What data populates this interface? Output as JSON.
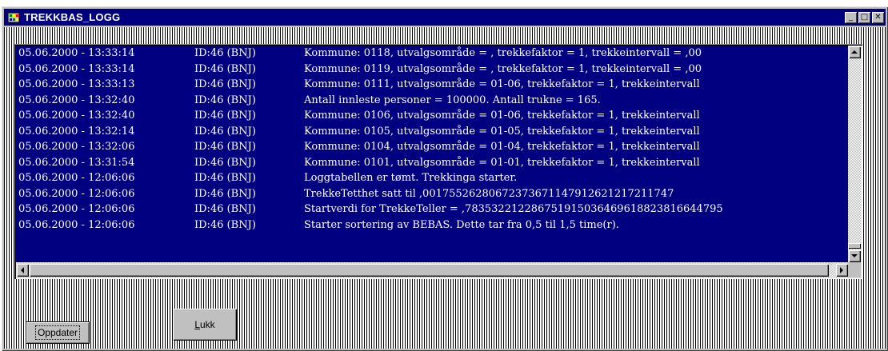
{
  "window": {
    "title": "TREKKBAS_LOGG",
    "controls": {
      "minimize": "_",
      "maximize": "□",
      "close": "✕"
    },
    "app_icon": "app-grid-icon",
    "colors": {
      "titlebar": "#000080",
      "face": "#c0c0c0",
      "selection": "#000080"
    }
  },
  "log": {
    "rows": [
      {
        "timestamp": "05.06.2000 - 13:33:14",
        "id": "ID:46 (BNJ)",
        "message": "Kommune: 0118, utvalgsområde = , trekkefaktor = 1, trekkeintervall = ,00"
      },
      {
        "timestamp": "05.06.2000 - 13:33:14",
        "id": "ID:46 (BNJ)",
        "message": "Kommune: 0119, utvalgsområde = , trekkefaktor = 1, trekkeintervall = ,00"
      },
      {
        "timestamp": "05.06.2000 - 13:33:13",
        "id": "ID:46 (BNJ)",
        "message": "Kommune: 0111, utvalgsområde = 01-06, trekkefaktor = 1, trekkeintervall"
      },
      {
        "timestamp": "05.06.2000 - 13:32:40",
        "id": "ID:46 (BNJ)",
        "message": "Antall innleste personer = 100000. Antall trukne = 165."
      },
      {
        "timestamp": "05.06.2000 - 13:32:40",
        "id": "ID:46 (BNJ)",
        "message": "Kommune: 0106, utvalgsområde = 01-06, trekkefaktor = 1, trekkeintervall"
      },
      {
        "timestamp": "05.06.2000 - 13:32:14",
        "id": "ID:46 (BNJ)",
        "message": "Kommune: 0105, utvalgsområde = 01-05, trekkefaktor = 1, trekkeintervall"
      },
      {
        "timestamp": "05.06.2000 - 13:32:06",
        "id": "ID:46 (BNJ)",
        "message": "Kommune: 0104, utvalgsområde = 01-04, trekkefaktor = 1, trekkeintervall"
      },
      {
        "timestamp": "05.06.2000 - 13:31:54",
        "id": "ID:46 (BNJ)",
        "message": "Kommune: 0101, utvalgsområde = 01-01, trekkefaktor = 1, trekkeintervall"
      },
      {
        "timestamp": "05.06.2000 - 12:06:06",
        "id": "ID:46 (BNJ)",
        "message": "Loggtabellen er tømt. Trekkinga starter."
      },
      {
        "timestamp": "05.06.2000 - 12:06:06",
        "id": "ID:46 (BNJ)",
        "message": "TrekkeTetthet satt til ,00175526280672373671147912621217211747"
      },
      {
        "timestamp": "05.06.2000 - 12:06:06",
        "id": "ID:46 (BNJ)",
        "message": "Startverdi for TrekkeTeller = ,78353221228675191503646961882381664479​5"
      },
      {
        "timestamp": "05.06.2000 - 12:06:06",
        "id": "ID:46 (BNJ)",
        "message": "Starter sortering av BEBAS. Dette tar fra 0,5 til 1,5 time(r)."
      }
    ]
  },
  "buttons": {
    "update_label": "Oppdater",
    "close_label": "Lukk"
  }
}
